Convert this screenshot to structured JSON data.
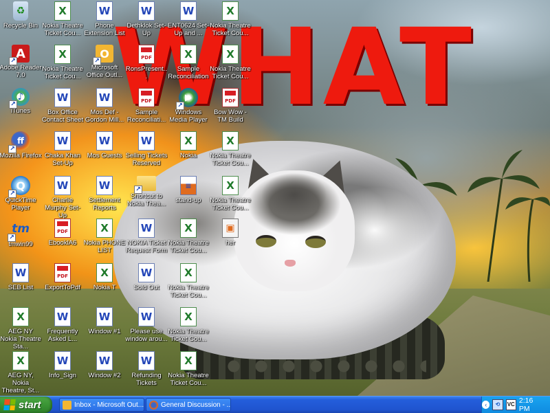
{
  "wallpaper": {
    "caption": "WHAT"
  },
  "desktop": {
    "icons": [
      {
        "label": "Recycle Bin",
        "icon": "recycle-bin-icon"
      },
      {
        "label": "Nokia Theatre Ticket Cou...",
        "icon": "excel-icon"
      },
      {
        "label": "Phone Extension List",
        "icon": "word-icon"
      },
      {
        "label": "Dethklok Set-Up",
        "icon": "word-icon"
      },
      {
        "label": "ENT0624 Set-Up and ...",
        "icon": "word-icon"
      },
      {
        "label": "Nokia Theatre Ticket Cou...",
        "icon": "excel-icon"
      },
      {
        "label": "Adobe Reader 7.0",
        "icon": "adobe-reader-icon"
      },
      {
        "label": "Nokia Theatre Ticket Cou...",
        "icon": "excel-icon"
      },
      {
        "label": "Microsoft Office Outl...",
        "icon": "outlook-icon"
      },
      {
        "label": "RonsPresent...",
        "icon": "pdf-icon"
      },
      {
        "label": "Sample Reconciliation",
        "icon": "excel-icon"
      },
      {
        "label": "Nokia Theatre Ticket Cou...",
        "icon": "excel-icon"
      },
      {
        "label": "iTunes",
        "icon": "itunes-icon"
      },
      {
        "label": "Box Office Contact Sheet",
        "icon": "word-icon"
      },
      {
        "label": "Mos Def - Gordon Mill...",
        "icon": "word-icon"
      },
      {
        "label": "Sample Reconciliati...",
        "icon": "pdf-icon"
      },
      {
        "label": "Windows Media Player",
        "icon": "windows-media-player-icon"
      },
      {
        "label": "Bow Wow - TM Build",
        "icon": "pdf-icon"
      },
      {
        "label": "Mozilla Firefox",
        "icon": "firefox-icon"
      },
      {
        "label": "Chaka Khan Set-Up",
        "icon": "word-icon"
      },
      {
        "label": "Mos Guests",
        "icon": "word-icon"
      },
      {
        "label": "Selling Tickets Reserved",
        "icon": "word-icon"
      },
      {
        "label": "Nokia",
        "icon": "excel-icon"
      },
      {
        "label": "Nokia Theatre Ticket Cou...",
        "icon": "excel-icon"
      },
      {
        "label": "QuickTime Player",
        "icon": "quicktime-icon"
      },
      {
        "label": "Charlie Murphy Set-Up",
        "icon": "word-icon"
      },
      {
        "label": "Settlement Reports",
        "icon": "word-icon"
      },
      {
        "label": "Shortcut to Nokia Thea...",
        "icon": "folder-shortcut-icon"
      },
      {
        "label": "stand-up",
        "icon": "document-icon"
      },
      {
        "label": "Nokia Theatre Ticket Cou...",
        "icon": "excel-icon"
      },
      {
        "label": "tmwin99",
        "icon": "tm-icon"
      },
      {
        "label": "EbooklA6",
        "icon": "pdf-icon"
      },
      {
        "label": "Nokia PHONE LIST",
        "icon": "excel-icon"
      },
      {
        "label": "NOKIA Ticket Request Form",
        "icon": "word-icon"
      },
      {
        "label": "Nokia Theatre Ticket Cou...",
        "icon": "excel-icon"
      },
      {
        "label": "her",
        "icon": "image-icon"
      },
      {
        "label": "SEB List",
        "icon": "word-icon"
      },
      {
        "label": "ExportToPdf",
        "icon": "pdf-icon"
      },
      {
        "label": "Nokia T",
        "icon": "excel-icon"
      },
      {
        "label": "Sold Out",
        "icon": "word-icon"
      },
      {
        "label": "Nokia Theatre Ticket Cou...",
        "icon": "excel-icon"
      },
      {
        "label": "AEG NY Nokia Theatre Sta...",
        "icon": "excel-icon"
      },
      {
        "label": "Frequently Asked L...",
        "icon": "word-icon"
      },
      {
        "label": "Window #1",
        "icon": "word-icon"
      },
      {
        "label": "Please use window arou...",
        "icon": "word-icon"
      },
      {
        "label": "Nokia Theatre Ticket Cou...",
        "icon": "excel-icon"
      },
      {
        "label": "AEG NY, Nokia Theatre, St...",
        "icon": "excel-icon"
      },
      {
        "label": "Info_Sign",
        "icon": "word-icon"
      },
      {
        "label": "Window #2",
        "icon": "word-icon"
      },
      {
        "label": "Refunding Tickets",
        "icon": "word-icon"
      },
      {
        "label": "Nokia Theatre Ticket Cou...",
        "icon": "excel-icon"
      }
    ]
  },
  "taskbar": {
    "start_label": "start",
    "tasks": [
      {
        "label": "Inbox - Microsoft Out...",
        "icon": "outlook-icon",
        "color": "#f2b632"
      },
      {
        "label": "General Discussion - ...",
        "icon": "firefox-icon",
        "color": "#e3681b"
      }
    ],
    "tray": {
      "clock": "2:16 PM",
      "icons": [
        "back-arrow-icon",
        "network-icon",
        "vc-icon"
      ],
      "vc_label": "VC"
    }
  },
  "colors": {
    "taskbar_blue": "#245edb",
    "start_green": "#3c9736",
    "caption_red": "#ee1a0e",
    "tray_blue": "#0f8ce0"
  }
}
